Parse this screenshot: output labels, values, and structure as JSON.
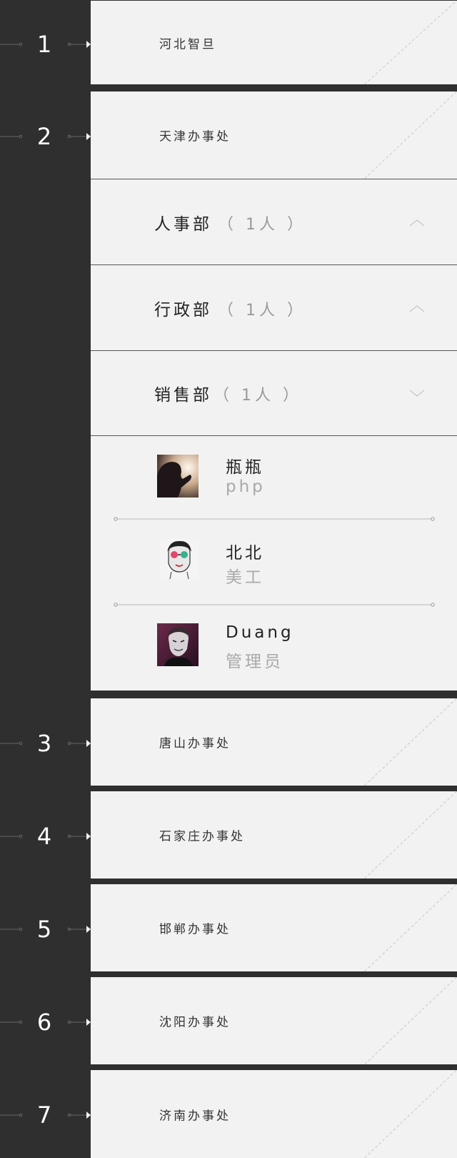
{
  "branches": [
    {
      "number": "1",
      "label": "河北智旦"
    },
    {
      "number": "2",
      "label": "天津办事处"
    },
    {
      "number": "3",
      "label": "唐山办事处"
    },
    {
      "number": "4",
      "label": "石家庄办事处"
    },
    {
      "number": "5",
      "label": "邯郸办事处"
    },
    {
      "number": "6",
      "label": "沈阳办事处"
    },
    {
      "number": "7",
      "label": "济南办事处"
    }
  ],
  "departments": [
    {
      "name": "人事部",
      "count": "（ 1人 ）",
      "expanded": false
    },
    {
      "name": "行政部",
      "count": "（ 1人 ）",
      "expanded": false
    },
    {
      "name": "销售部",
      "count": "（ 1人 ）",
      "expanded": true
    }
  ],
  "members": [
    {
      "name": "瓶瓶",
      "role": "php",
      "avatar": "woman-silhouette-avatar"
    },
    {
      "name": "北北",
      "role": "美工",
      "avatar": "sunglasses-girl-avatar"
    },
    {
      "name": "Duang",
      "role": "管理员",
      "avatar": "masked-man-avatar"
    }
  ],
  "colors": {
    "rail": "#2f2f2f",
    "card": "#f2f2f2",
    "text": "#333333",
    "muted": "#9a9a9a"
  }
}
